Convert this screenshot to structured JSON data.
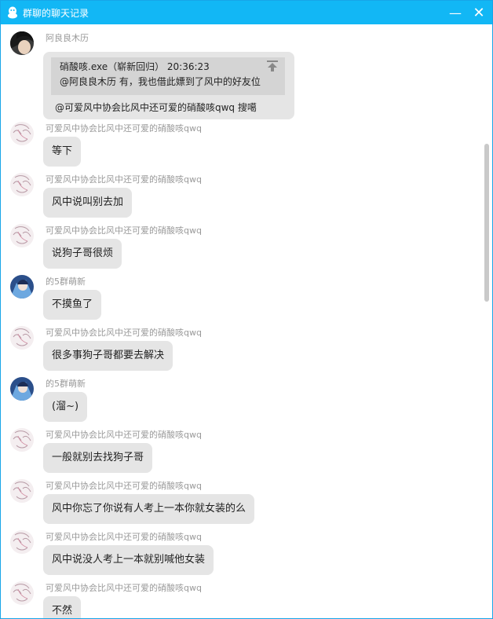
{
  "window": {
    "title": "群聊的聊天记录",
    "minimize_label": "—",
    "close_label": "✕"
  },
  "messages": [
    {
      "sender": "阿良良木历",
      "avatar": "dark-anime-avatar",
      "type": "quote",
      "quote_header": "硝酸咳.exe（崭新回归）  20:36:23",
      "quote_text": "@阿良良木历 有，我也借此嫖到了风中的好友位",
      "text": "@可爱风中协会比风中还可爱的硝酸咳qwq 搜噶"
    },
    {
      "sender": "可爱风中协会比风中还可爱的硝酸咳qwq",
      "avatar": "sketch-girl-avatar",
      "text": "等下"
    },
    {
      "sender": "可爱风中协会比风中还可爱的硝酸咳qwq",
      "avatar": "sketch-girl-avatar",
      "text": "风中说叫别去加"
    },
    {
      "sender": "可爱风中协会比风中还可爱的硝酸咳qwq",
      "avatar": "sketch-girl-avatar",
      "text": "说狗子哥很烦"
    },
    {
      "sender": "的5群萌新",
      "avatar": "blue-anime-avatar",
      "text": "不摸鱼了"
    },
    {
      "sender": "可爱风中协会比风中还可爱的硝酸咳qwq",
      "avatar": "sketch-girl-avatar",
      "text": "很多事狗子哥都要去解决"
    },
    {
      "sender": "的5群萌新",
      "avatar": "blue-anime-avatar",
      "text": "(溜~)"
    },
    {
      "sender": "可爱风中协会比风中还可爱的硝酸咳qwq",
      "avatar": "sketch-girl-avatar",
      "text": "一般就别去找狗子哥"
    },
    {
      "sender": "可爱风中协会比风中还可爱的硝酸咳qwq",
      "avatar": "sketch-girl-avatar",
      "text": "风中你忘了你说有人考上一本你就女装的么"
    },
    {
      "sender": "可爱风中协会比风中还可爱的硝酸咳qwq",
      "avatar": "sketch-girl-avatar",
      "text": "风中说没人考上一本就别喊他女装"
    },
    {
      "sender": "可爱风中协会比风中还可爱的硝酸咳qwq",
      "avatar": "sketch-girl-avatar",
      "text": "不然"
    }
  ],
  "colors": {
    "titlebar": "#12b7f5",
    "bubble": "#e5e5e5",
    "quote_box": "#d4d4d4",
    "name_text": "#999999"
  }
}
